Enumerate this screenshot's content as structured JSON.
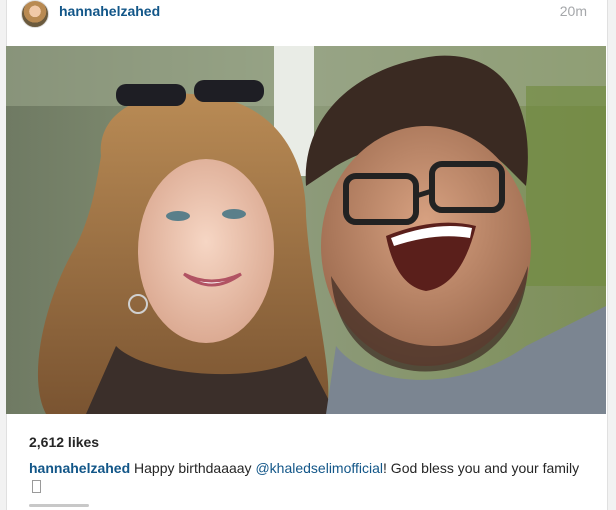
{
  "post": {
    "username": "hannahelzahed",
    "timestamp": "20m",
    "likes": "2,612 likes",
    "caption": {
      "username": "hannahelzahed",
      "text_before": " Happy birthdaaaay ",
      "mention": "@khaledselimofficial",
      "text_after": "! God bless you and your family",
      "emoji": "unsupported-glyph-box"
    },
    "photo_icon": "photo-image"
  },
  "colors": {
    "link": "#125688",
    "text": "#262626",
    "muted": "#a5a7aa"
  }
}
